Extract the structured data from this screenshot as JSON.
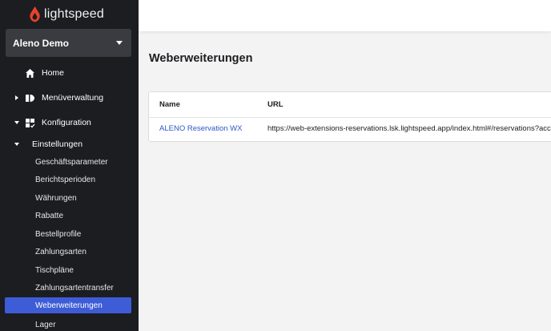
{
  "brand": {
    "name": "lightspeed",
    "color": "#e8412c"
  },
  "account": {
    "name": "Aleno Demo"
  },
  "nav": {
    "home": "Home",
    "menu": "Menüverwaltung",
    "config": "Konfiguration",
    "settings": "Einstellungen",
    "sub_items": [
      "Geschäftsparameter",
      "Berichtsperioden",
      "Währungen",
      "Rabatte",
      "Bestellprofile",
      "Zahlungsarten",
      "Tischpläne",
      "Zahlungsartentransfer",
      "Weberweiterungen",
      "Lager"
    ],
    "active_index": 8,
    "active_color": "#3d5cd6"
  },
  "page": {
    "title": "Weberweiterungen"
  },
  "table": {
    "columns": [
      "Name",
      "URL"
    ],
    "rows": [
      {
        "name": "ALENO Reservation WX",
        "url": "https://web-extensions-reservations.lsk.lightspeed.app/index.html#/reservations?acce"
      }
    ]
  }
}
